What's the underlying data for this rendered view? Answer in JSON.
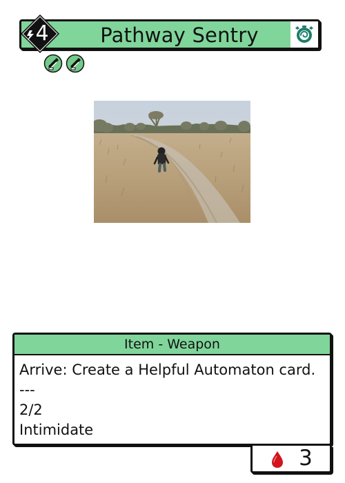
{
  "card": {
    "title": "Pathway Sentry",
    "cost": "4",
    "cost_icon": "lightning-icon",
    "type_icon": "sloth-timer-icon",
    "badges": [
      {
        "icon": "sigil-badge-icon"
      },
      {
        "icon": "sigil-badge-icon"
      }
    ],
    "art_description_icon": "child-walking-on-dirt-path-image",
    "type_line": "Item - Weapon",
    "rules": {
      "ability": "Arrive: Create a Helpful Automaton card.",
      "separator": "---",
      "stats": "2/2",
      "keyword": "Intimidate"
    },
    "blood_cost": "3",
    "blood_icon": "blood-drop-icon"
  },
  "colors": {
    "frame_green": "#80d59a",
    "badge_green": "#74ca8b",
    "ink": "#111111",
    "blood_red": "#d2141d",
    "icon_teal": "#1d7e6b"
  }
}
